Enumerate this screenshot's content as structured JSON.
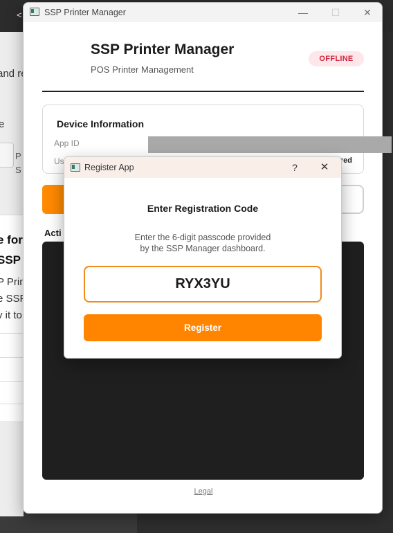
{
  "background": {
    "frag_1": "and re",
    "frag_2": "e",
    "frag_3": "P",
    "frag_4": "S",
    "frag_5": "e for",
    "frag_6": "SSP",
    "frag_7": "P Prin",
    "frag_8": "e SSP",
    "frag_9": "y it to"
  },
  "window": {
    "title": "SSP Printer Manager",
    "minimize": "—",
    "maximize": "☐",
    "close": "✕"
  },
  "header": {
    "title": "SSP Printer Manager",
    "subtitle": "POS Printer Management",
    "status": "OFFLINE"
  },
  "device": {
    "title": "Device Information",
    "app_id_label": "App ID",
    "username_label": "Username",
    "username_value": "Not registered"
  },
  "activity": {
    "label": "Acti"
  },
  "footer": {
    "legal": "Legal"
  },
  "dialog": {
    "title": "Register App",
    "help": "?",
    "close": "✕",
    "heading": "Enter Registration Code",
    "description_line1": "Enter the 6-digit passcode provided",
    "description_line2": "by the SSP Manager dashboard.",
    "code_value": "RYX3YU",
    "register_label": "Register"
  },
  "colors": {
    "accent": "#ff8400",
    "offline_bg": "#fde7ea",
    "offline_text": "#d0233a",
    "log_bg": "#1f1f1f"
  }
}
